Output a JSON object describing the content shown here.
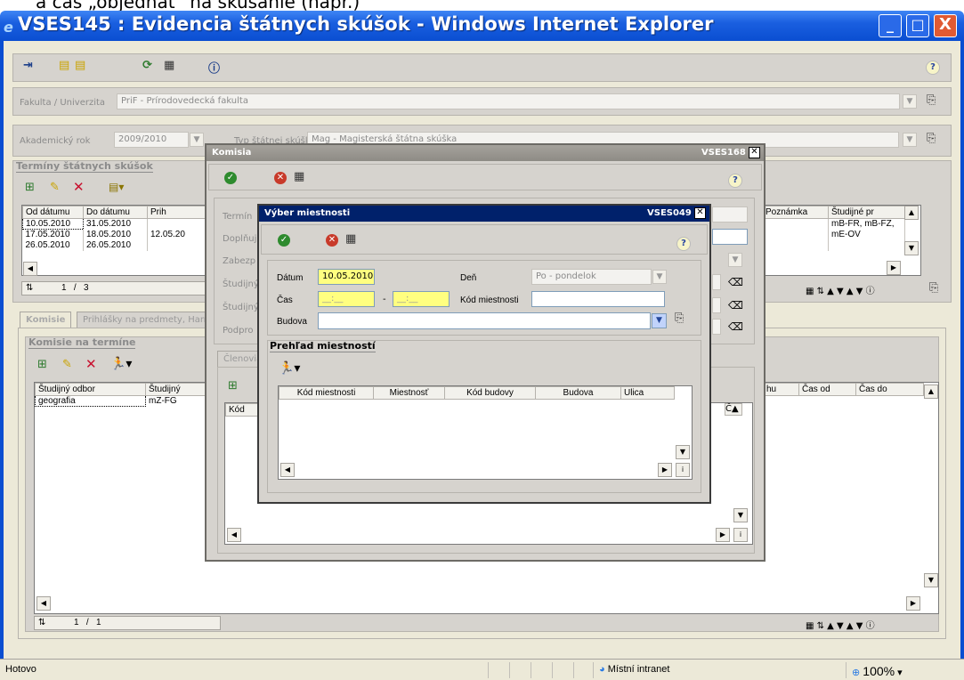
{
  "doc_fragment": "a čas „objednať“ na skúšanie (napr.)",
  "window": {
    "title": "VSES145 : Evidencia štátnych skúšok - Windows Internet Explorer",
    "min": "_",
    "max": "□",
    "close": "X"
  },
  "main": {
    "fakulta_label": "Fakulta / Univerzita",
    "fakulta_value": "PriF - Prírodovedecká fakulta",
    "rok_label": "Akademický rok",
    "rok_value": "2009/2010",
    "typ_label": "Typ štátnej skúšky",
    "typ_value": "Mag - Magisterská štátna skúška",
    "terminy_title": "Termíny štátnych skúšok",
    "terminy_columns": [
      "Od dátumu",
      "Do dátumu",
      "Prih"
    ],
    "terminy_rows": [
      [
        "10.05.2010",
        "31.05.2010",
        ""
      ],
      [
        "17.05.2010",
        "18.05.2010",
        "12.05.20"
      ],
      [
        "26.05.2010",
        "26.05.2010",
        ""
      ]
    ],
    "terminy_right_columns": [
      "Poznámka",
      "Študijné pr"
    ],
    "terminy_right_rows": [
      [
        "",
        "mB-FR, mB-FZ,"
      ],
      [
        "",
        "mE-OV"
      ],
      [
        "",
        ""
      ]
    ],
    "pager1": "1   /   3",
    "tab_komisie": "Komisie",
    "tab_prihlasky": "Prihlášky na predmety, Harm",
    "komisie_title": "Komisie na termíne",
    "komisie_columns": [
      "Študijný odbor",
      "Študijný"
    ],
    "komisie_rows": [
      [
        "geografia",
        "mZ-FG"
      ]
    ],
    "komisie_right_columns": [
      "hu",
      "Čas od",
      "Čas do"
    ],
    "pager2": "1   /   1"
  },
  "komisia": {
    "title": "Komisia",
    "code": "VSES168",
    "labels": [
      "Termín",
      "Doplňuj",
      "Zabezp",
      "Študijný",
      "Študijný",
      "Podpro"
    ],
    "tab": "Členovia",
    "col_kod": "Kód"
  },
  "vyber": {
    "title": "Výber miestnosti",
    "code": "VSES049",
    "datum_label": "Dátum",
    "datum_value": "10.05.2010",
    "den_label": "Deň",
    "den_value": "Po - pondelok",
    "cas_label": "Čas",
    "cas_from": "__:__",
    "cas_to": "__:__",
    "cas_dash": "-",
    "kod_label": "Kód miestnosti",
    "kod_value": "",
    "budova_label": "Budova",
    "budova_value": "",
    "prehlad_title": "Prehľad miestností",
    "columns": [
      "Kód miestnosti",
      "Miestnosť",
      "Kód budovy",
      "Budova",
      "Ulica"
    ]
  },
  "status": {
    "text": "Hotovo",
    "zone": "Místní intranet",
    "zoom": "100%"
  }
}
